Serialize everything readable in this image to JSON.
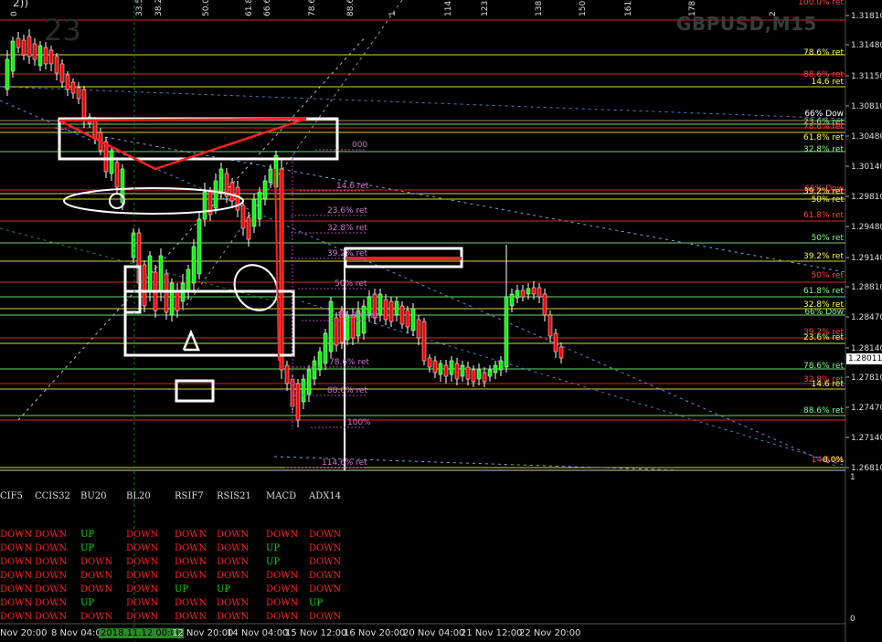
{
  "window": {
    "symbol_title": "GBPUSD,M15",
    "big_number": "23",
    "corner_text": "2))"
  },
  "top_axis_labels": [
    "0",
    "33.5",
    "38.2",
    "50.0",
    "61.8",
    "66.6",
    "78.6",
    "88.6",
    "1",
    "114.6",
    "123.6",
    "138.2",
    "150.0",
    "161.8",
    "178.6",
    "2"
  ],
  "price_axis": {
    "labels": [
      "1.31810",
      "1.31480",
      "1.31150",
      "1.30810",
      "1.30480",
      "1.30140",
      "1.29810",
      "1.29480",
      "1.29140",
      "1.28810",
      "1.28470",
      "1.28140",
      "1.27810",
      "1.27470",
      "1.27140",
      "1.26810"
    ],
    "current_price": "1.28011"
  },
  "fib_labels_right": [
    {
      "text": "100.0% ret",
      "color": "#ff4040"
    },
    {
      "text": "78.6% ret",
      "color": "#ffff40"
    },
    {
      "text": "88.6% ret",
      "color": "#ff4040"
    },
    {
      "text": "14.6 ret",
      "color": "#ffff40"
    },
    {
      "text": "66% Dow",
      "color": "#ffffff"
    },
    {
      "text": "23.6% ret",
      "color": "#80ff80"
    },
    {
      "text": "78.6% ret",
      "color": "#ff4040"
    },
    {
      "text": "61.8% ret",
      "color": "#ffff40"
    },
    {
      "text": "32.8% ret",
      "color": "#80ff80"
    },
    {
      "text": "66% Dow",
      "color": "#ff4040"
    },
    {
      "text": "39.2% ret",
      "color": "#ffff40"
    },
    {
      "text": "50% ret",
      "color": "#ffff40"
    },
    {
      "text": "61.8% ret",
      "color": "#ff4040"
    },
    {
      "text": "50% ret",
      "color": "#80ff80"
    },
    {
      "text": "39.2% ret",
      "color": "#ffff40"
    },
    {
      "text": "50% ret",
      "color": "#ff4040"
    },
    {
      "text": "61.8% ret",
      "color": "#80ff80"
    },
    {
      "text": "32.8% ret",
      "color": "#ffff40"
    },
    {
      "text": "66% Dow",
      "color": "#80ff80"
    },
    {
      "text": "39.2% ret",
      "color": "#ff4040"
    },
    {
      "text": "23.6% ret",
      "color": "#ffff40"
    },
    {
      "text": "78.6% ret",
      "color": "#80ff80"
    },
    {
      "text": "32.8% ret",
      "color": "#ff4040"
    },
    {
      "text": "14.6 ret",
      "color": "#ffff40"
    },
    {
      "text": "88.6% ret",
      "color": "#80ff80"
    },
    {
      "text": "14.6 ret",
      "color": "#ff4040"
    },
    {
      "text": "0.0%",
      "color": "#ffff40"
    }
  ],
  "fib_labels_mid": [
    "000",
    "14.6 ret",
    "23.6% ret",
    "32.8% ret",
    "39.2% ret",
    "50% ret",
    "61.8% ret",
    "78.6% ret",
    "88.6% ret",
    "100%",
    "114.6% ret"
  ],
  "indicator_panel": {
    "headers": [
      "CIF5",
      "CCIS32",
      "BU20",
      "BL20",
      "RSIF7",
      "RSIS21",
      "MACD",
      "ADX14"
    ],
    "rows": [
      [
        "DOWN",
        "DOWN",
        "UP",
        "DOWN",
        "DOWN",
        "DOWN",
        "DOWN",
        "DOWN"
      ],
      [
        "DOWN",
        "DOWN",
        "UP",
        "DOWN",
        "DOWN",
        "DOWN",
        "UP",
        "DOWN"
      ],
      [
        "DOWN",
        "DOWN",
        "DOWN",
        "DOWN",
        "DOWN",
        "DOWN",
        "UP",
        "DOWN"
      ],
      [
        "DOWN",
        "DOWN",
        "DOWN",
        "DOWN",
        "DOWN",
        "DOWN",
        "DOWN",
        "DOWN"
      ],
      [
        "DOWN",
        "DOWN",
        "DOWN",
        "DOWN",
        "UP",
        "UP",
        "DOWN",
        "DOWN"
      ],
      [
        "DOWN",
        "DOWN",
        "UP",
        "DOWN",
        "DOWN",
        "DOWN",
        "DOWN",
        "UP"
      ],
      [
        "DOWN",
        "DOWN",
        "DOWN",
        "DOWN",
        "DOWN",
        "DOWN",
        "DOWN",
        "DOWN"
      ]
    ],
    "scale_top": "1",
    "scale_bottom": "0"
  },
  "time_axis": [
    "Nov 20:00",
    "8 Nov 04:00",
    "2018.11.12 00:00",
    "12 Nov 20:00",
    "14 Nov 04:00",
    "15 Nov 12:00",
    "16 Nov 20:00",
    "20 Nov 04:00",
    "21 Nov 12:00",
    "22 Nov 20:00"
  ],
  "colors": {
    "up": "#00e000",
    "down": "#ff2020",
    "bull_candle": "#00ff00",
    "bear_candle": "#ff0000"
  }
}
